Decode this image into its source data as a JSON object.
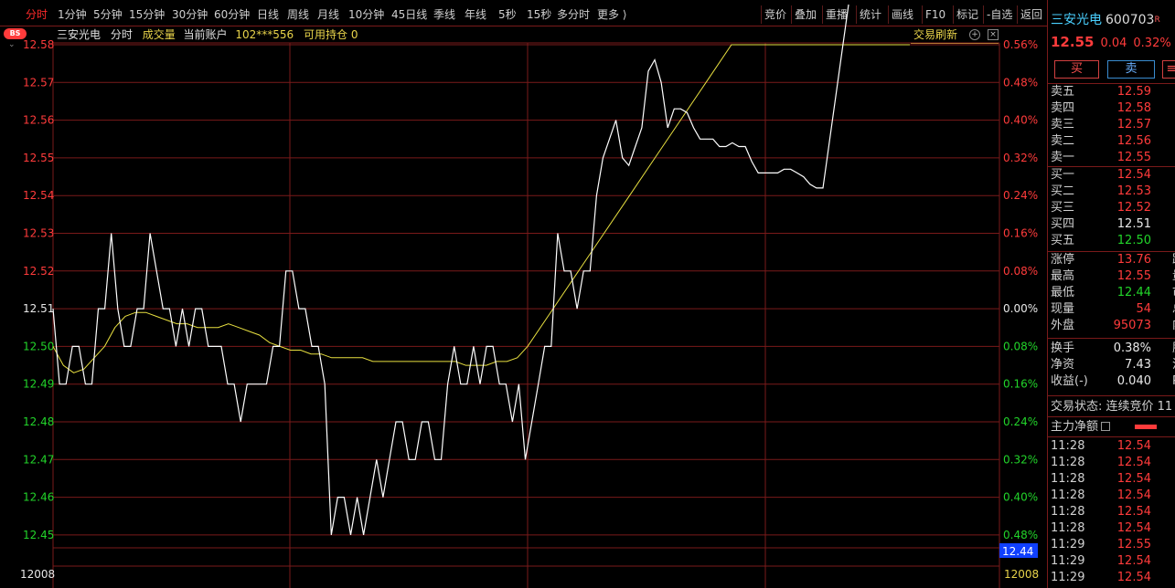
{
  "toolbar": {
    "periods": [
      {
        "label": "分时",
        "x": 28,
        "active": true
      },
      {
        "label": "1分钟",
        "x": 63
      },
      {
        "label": "5分钟",
        "x": 102
      },
      {
        "label": "15分钟",
        "x": 141
      },
      {
        "label": "30分钟",
        "x": 188
      },
      {
        "label": "60分钟",
        "x": 234
      },
      {
        "label": "日线",
        "x": 281
      },
      {
        "label": "周线",
        "x": 314
      },
      {
        "label": "月线",
        "x": 347
      },
      {
        "label": "10分钟",
        "x": 381
      },
      {
        "label": "45日线",
        "x": 428
      },
      {
        "label": "季线",
        "x": 474
      },
      {
        "label": "年线",
        "x": 508
      },
      {
        "label": "5秒",
        "x": 545
      },
      {
        "label": "15秒",
        "x": 576
      },
      {
        "label": "多分时",
        "x": 609
      },
      {
        "label": "更多 ⟩",
        "x": 653
      }
    ],
    "tools": [
      {
        "label": "竞价",
        "x": 836
      },
      {
        "label": "叠加",
        "x": 869
      },
      {
        "label": "重播",
        "x": 903
      },
      {
        "label": "统计",
        "x": 940
      },
      {
        "label": "画线",
        "x": 975
      },
      {
        "label": "F10",
        "x": 1012
      },
      {
        "label": "标记",
        "x": 1046
      },
      {
        "label": "-自选",
        "x": 1079
      },
      {
        "label": "返回",
        "x": 1116
      }
    ]
  },
  "badge": "BS",
  "info": {
    "stock_name": "三安光电",
    "mode": "分时",
    "volume": "成交量",
    "account_label": "当前账户",
    "account": "102***556",
    "holding": "可用持仓 0"
  },
  "refresh_label": "交易刷新",
  "axes": {
    "left_labels": [
      "12.58",
      "12.57",
      "12.56",
      "12.55",
      "12.54",
      "12.53",
      "12.52",
      "12.51",
      "12.50",
      "12.49",
      "12.48",
      "12.47",
      "12.46",
      "12.45"
    ],
    "right_labels": [
      "0.56%",
      "0.48%",
      "0.40%",
      "0.32%",
      "0.24%",
      "0.16%",
      "0.08%",
      "0.00%",
      "0.08%",
      "0.16%",
      "0.24%",
      "0.32%",
      "0.40%",
      "0.48%"
    ],
    "vol_left": "12008",
    "vol_right": "12008",
    "price_tag": "12.44"
  },
  "colors": {
    "grid": "#7a1a1a",
    "price_line": "#ffffff",
    "avg_line": "#e8e040",
    "up": "#ff3b3b",
    "down": "#22d42a",
    "accent_blue": "#1040ff"
  },
  "chart_data": {
    "type": "line",
    "ylim": [
      12.45,
      12.58
    ],
    "prev_close": 12.51,
    "series": [
      {
        "name": "price",
        "values": [
          12.51,
          12.49,
          12.49,
          12.5,
          12.5,
          12.49,
          12.49,
          12.51,
          12.51,
          12.53,
          12.51,
          12.5,
          12.5,
          12.51,
          12.51,
          12.53,
          12.52,
          12.51,
          12.51,
          12.5,
          12.51,
          12.5,
          12.51,
          12.51,
          12.5,
          12.5,
          12.5,
          12.49,
          12.49,
          12.48,
          12.49,
          12.49,
          12.49,
          12.49,
          12.5,
          12.5,
          12.52,
          12.52,
          12.51,
          12.51,
          12.5,
          12.5,
          12.49,
          12.45,
          12.46,
          12.46,
          12.45,
          12.46,
          12.45,
          12.46,
          12.47,
          12.46,
          12.47,
          12.48,
          12.48,
          12.47,
          12.47,
          12.48,
          12.48,
          12.47,
          12.47,
          12.49,
          12.5,
          12.49,
          12.49,
          12.5,
          12.49,
          12.5,
          12.5,
          12.49,
          12.49,
          12.48,
          12.49,
          12.47,
          12.48,
          12.49,
          12.5,
          12.5,
          12.53,
          12.52,
          12.52,
          12.51,
          12.52,
          12.52,
          12.54,
          12.55,
          12.555,
          12.56,
          12.55,
          12.548,
          12.553,
          12.558,
          12.573,
          12.576,
          12.57,
          12.558,
          12.563,
          12.563,
          12.562,
          12.558,
          12.555,
          12.555,
          12.555,
          12.553,
          12.553,
          12.554,
          12.553,
          12.553,
          12.549,
          12.546,
          12.546,
          12.546,
          12.546,
          12.547,
          12.547,
          12.546,
          12.545,
          12.543,
          12.542,
          12.542,
          12.59
        ]
      },
      {
        "name": "avg",
        "values": [
          12.5,
          12.495,
          12.493,
          12.494,
          12.497,
          12.5,
          12.505,
          12.508,
          12.509,
          12.509,
          12.508,
          12.507,
          12.506,
          12.506,
          12.505,
          12.505,
          12.505,
          12.506,
          12.505,
          12.504,
          12.503,
          12.501,
          12.5,
          12.499,
          12.499,
          12.498,
          12.498,
          12.497,
          12.497,
          12.497,
          12.497,
          12.496,
          12.496,
          12.496,
          12.496,
          12.496,
          12.496,
          12.496,
          12.496,
          12.496,
          12.495,
          12.495,
          12.495,
          12.496,
          12.496,
          12.497,
          12.5,
          12.51,
          12.52,
          12.53,
          12.54,
          12.55,
          12.56,
          12.57,
          12.58,
          12.58,
          12.58,
          12.58,
          12.58,
          12.58,
          12.58,
          12.58
        ]
      }
    ]
  },
  "right_panel": {
    "stock_name": "三安光电",
    "code": "600703",
    "code_suffix": "R",
    "price": "12.55",
    "change": "0.04",
    "change_pct": "0.32%",
    "buy": "买",
    "sell": "卖",
    "more": "≡",
    "asks": [
      {
        "label": "卖五",
        "price": "12.59",
        "color": "red"
      },
      {
        "label": "卖四",
        "price": "12.58",
        "color": "red"
      },
      {
        "label": "卖三",
        "price": "12.57",
        "color": "red"
      },
      {
        "label": "卖二",
        "price": "12.56",
        "color": "red"
      },
      {
        "label": "卖一",
        "price": "12.55",
        "color": "red"
      }
    ],
    "bids": [
      {
        "label": "买一",
        "price": "12.54",
        "color": "red"
      },
      {
        "label": "买二",
        "price": "12.53",
        "color": "red"
      },
      {
        "label": "买三",
        "price": "12.52",
        "color": "red"
      },
      {
        "label": "买四",
        "price": "12.51",
        "color": "white"
      },
      {
        "label": "买五",
        "price": "12.50",
        "color": "green"
      }
    ],
    "stats1": [
      {
        "label": "涨停",
        "value": "13.76",
        "color": "red",
        "label2": "跌停"
      },
      {
        "label": "最高",
        "value": "12.55",
        "color": "red",
        "label2": "量比"
      },
      {
        "label": "最低",
        "value": "12.44",
        "color": "green",
        "label2": "市值"
      },
      {
        "label": "现量",
        "value": "54",
        "color": "red",
        "label2": "总量"
      },
      {
        "label": "外盘",
        "value": "95073",
        "color": "red",
        "label2": "内盘"
      }
    ],
    "stats2": [
      {
        "label": "换手",
        "value": "0.38%",
        "color": "white",
        "label2": "股本"
      },
      {
        "label": "净资",
        "value": "7.43",
        "color": "white",
        "label2": "流通"
      },
      {
        "label": "收益(-)",
        "value": "0.040",
        "color": "white",
        "label2": "PE("
      }
    ],
    "trade_status_label": "交易状态:",
    "trade_status_value": "连续竞价 11",
    "net_flow_label": "主力净额",
    "ticks": [
      {
        "time": "11:28",
        "price": "12.54"
      },
      {
        "time": "11:28",
        "price": "12.54"
      },
      {
        "time": "11:28",
        "price": "12.54"
      },
      {
        "time": "11:28",
        "price": "12.54"
      },
      {
        "time": "11:28",
        "price": "12.54"
      },
      {
        "time": "11:28",
        "price": "12.54"
      },
      {
        "time": "11:29",
        "price": "12.55"
      },
      {
        "time": "11:29",
        "price": "12.54"
      },
      {
        "time": "11:29",
        "price": "12.54"
      }
    ]
  }
}
